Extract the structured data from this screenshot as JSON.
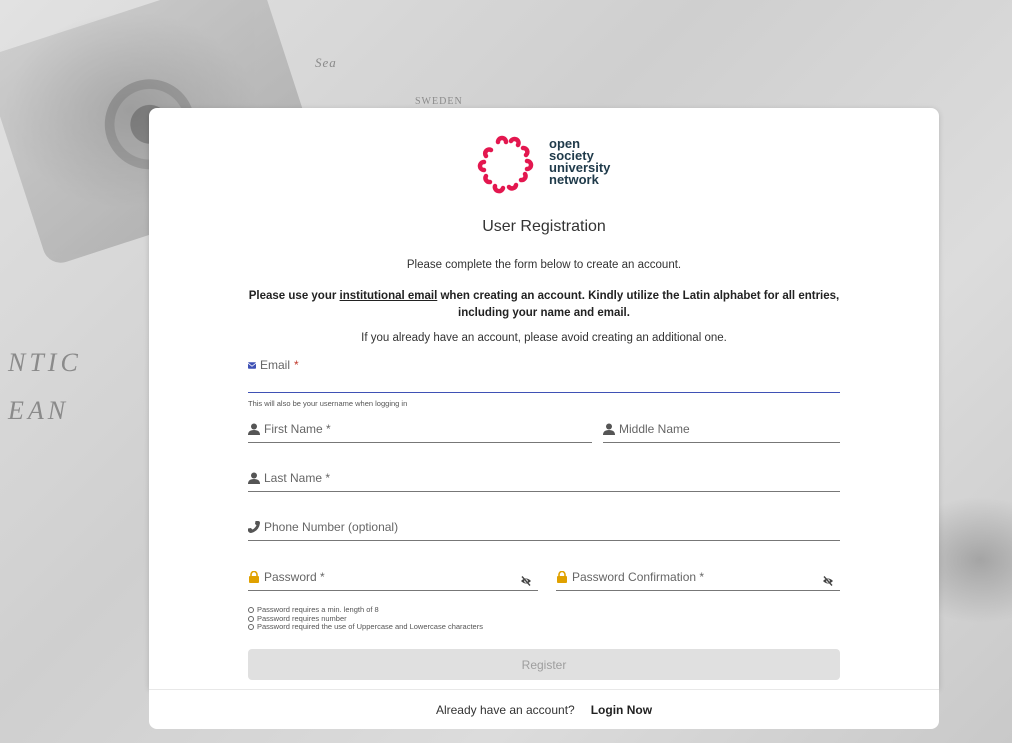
{
  "background": {
    "map_labels": [
      "NTIC",
      "EAN",
      "SWEDEN",
      "Sea"
    ]
  },
  "logo": {
    "line1": "open",
    "line2": "society",
    "line3": "university",
    "line4": "network",
    "accent_color": "#e3174f",
    "text_color": "#1f3a4a"
  },
  "form": {
    "title": "User Registration",
    "intro": "Please complete the form below to create an account.",
    "notice_before": "Please use your ",
    "notice_link": "institutional email",
    "notice_after": " when creating an account. Kindly utilize the Latin alphabet for all entries, including your name and email.",
    "already_notice": "If you already have an account, please avoid creating an additional one.",
    "email": {
      "label": "Email",
      "required_mark": "*",
      "value": "",
      "hint": "This will also be your username when logging in",
      "icon": "envelope-icon"
    },
    "first_name": {
      "label": "First Name *",
      "value": "",
      "icon": "user-icon"
    },
    "middle_name": {
      "label": "Middle Name",
      "value": "",
      "icon": "user-icon"
    },
    "last_name": {
      "label": "Last Name *",
      "value": "",
      "icon": "user-icon"
    },
    "phone": {
      "label": "Phone Number (optional)",
      "value": "",
      "icon": "phone-icon"
    },
    "password": {
      "label": "Password *",
      "value": "",
      "icon": "lock-icon"
    },
    "password_confirmation": {
      "label": "Password Confirmation *",
      "value": "",
      "icon": "lock-icon"
    },
    "password_rules": [
      "Password requires a min. length of 8",
      "Password requires number",
      "Password required the use of Uppercase and Lowercase characters"
    ],
    "register_label": "Register",
    "colors": {
      "focus": "#3f51b5",
      "lock": "#e0a100",
      "button_disabled": "#e0e0e0"
    }
  },
  "footer": {
    "prompt": "Already have an account?",
    "login_label": "Login Now"
  }
}
